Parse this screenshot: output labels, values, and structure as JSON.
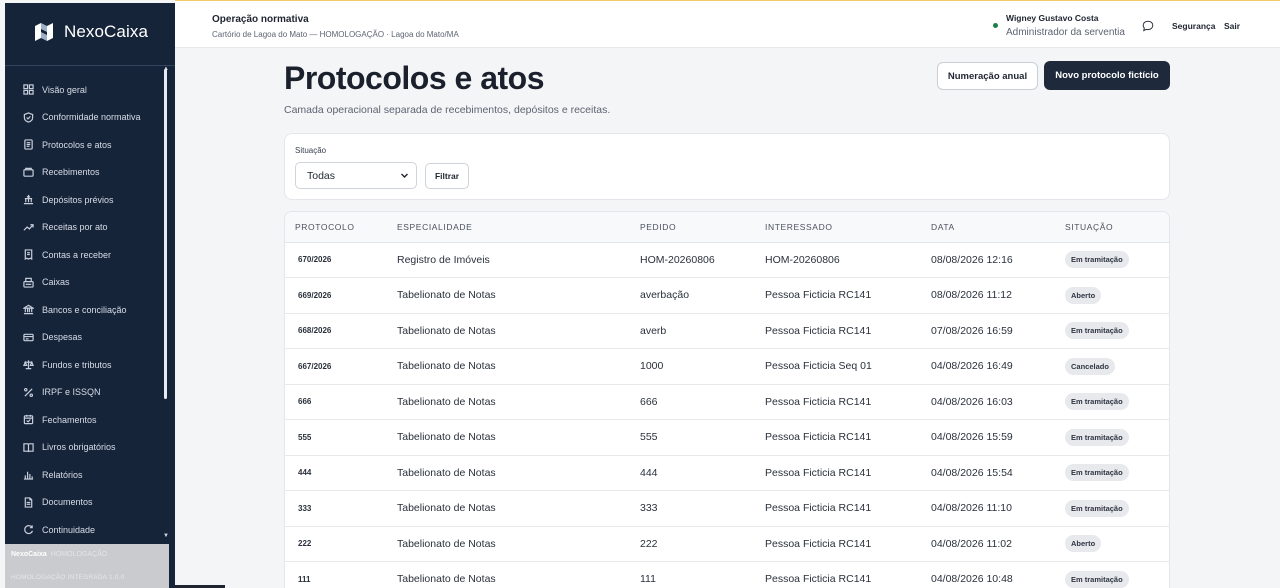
{
  "brand": {
    "name": "NexoCaixa"
  },
  "sidebar": {
    "items": [
      {
        "label": "Visão geral",
        "icon": "grid-icon"
      },
      {
        "label": "Conformidade normativa",
        "icon": "shield-check-icon"
      },
      {
        "label": "Protocolos e atos",
        "icon": "document-icon"
      },
      {
        "label": "Recebimentos",
        "icon": "wallet-icon"
      },
      {
        "label": "Depósitos prévios",
        "icon": "bank-deposit-icon"
      },
      {
        "label": "Receitas por ato",
        "icon": "trend-up-icon"
      },
      {
        "label": "Contas a receber",
        "icon": "receipt-icon"
      },
      {
        "label": "Caixas",
        "icon": "cash-register-icon"
      },
      {
        "label": "Bancos e conciliação",
        "icon": "bank-icon"
      },
      {
        "label": "Despesas",
        "icon": "card-icon"
      },
      {
        "label": "Fundos e tributos",
        "icon": "scale-icon"
      },
      {
        "label": "IRPF e ISSQN",
        "icon": "percent-icon"
      },
      {
        "label": "Fechamentos",
        "icon": "calendar-check-icon"
      },
      {
        "label": "Livros obrigatórios",
        "icon": "book-icon"
      },
      {
        "label": "Relatórios",
        "icon": "bar-chart-icon"
      },
      {
        "label": "Documentos",
        "icon": "file-icon"
      },
      {
        "label": "Continuidade",
        "icon": "refresh-icon"
      }
    ],
    "footer": {
      "line1": "NexoCaixa",
      "line1_faded": "HOMOLOGAÇÃO",
      "line2": "HOMOLOGAÇÃO INTEGRADA 1.0.0"
    }
  },
  "header": {
    "context_title": "Operação normativa",
    "context_subtitle": "Cartório de Lagoa do Mato — HOMOLOGAÇÃO · Lagoa do Mato/MA",
    "user_name": "Wigney Gustavo Costa",
    "user_role": "Administrador da serventia",
    "security_label": "Segurança",
    "logout_label": "Sair"
  },
  "main": {
    "title": "Protocolos e atos",
    "subtitle": "Camada operacional separada de recebimentos, depósitos e receitas.",
    "btn_annual": "Numeração anual",
    "btn_new": "Novo protocolo fictício",
    "filter": {
      "label": "Situação",
      "selected": "Todas",
      "button": "Filtrar"
    },
    "table": {
      "headers": [
        "PROTOCOLO",
        "ESPECIALIDADE",
        "PEDIDO",
        "INTERESSADO",
        "DATA",
        "SITUAÇÃO"
      ],
      "rows": [
        [
          "670/2026",
          "Registro de Imóveis",
          "HOM-20260806",
          "HOM-20260806",
          "08/08/2026 12:16",
          "Em tramitação"
        ],
        [
          "669/2026",
          "Tabelionato de Notas",
          "averbação",
          "Pessoa Ficticia RC141",
          "08/08/2026 11:12",
          "Aberto"
        ],
        [
          "668/2026",
          "Tabelionato de Notas",
          "averb",
          "Pessoa Ficticia RC141",
          "07/08/2026 16:59",
          "Em tramitação"
        ],
        [
          "667/2026",
          "Tabelionato de Notas",
          "1000",
          "Pessoa Ficticia Seq 01",
          "04/08/2026 16:49",
          "Cancelado"
        ],
        [
          "666",
          "Tabelionato de Notas",
          "666",
          "Pessoa Ficticia RC141",
          "04/08/2026 16:03",
          "Em tramitação"
        ],
        [
          "555",
          "Tabelionato de Notas",
          "555",
          "Pessoa Ficticia RC141",
          "04/08/2026 15:59",
          "Em tramitação"
        ],
        [
          "444",
          "Tabelionato de Notas",
          "444",
          "Pessoa Ficticia RC141",
          "04/08/2026 15:54",
          "Em tramitação"
        ],
        [
          "333",
          "Tabelionato de Notas",
          "333",
          "Pessoa Ficticia RC141",
          "04/08/2026 11:10",
          "Em tramitação"
        ],
        [
          "222",
          "Tabelionato de Notas",
          "222",
          "Pessoa Ficticia RC141",
          "04/08/2026 11:02",
          "Aberto"
        ],
        [
          "111",
          "Tabelionato de Notas",
          "111",
          "Pessoa Ficticia RC141",
          "04/08/2026 10:48",
          "Em tramitação"
        ]
      ]
    }
  },
  "colors": {
    "sidebar_bg": "#16243a",
    "primary_button": "#1e2a3c",
    "online_dot": "#1b7f4a",
    "badge_bg": "#e7e9ed"
  }
}
